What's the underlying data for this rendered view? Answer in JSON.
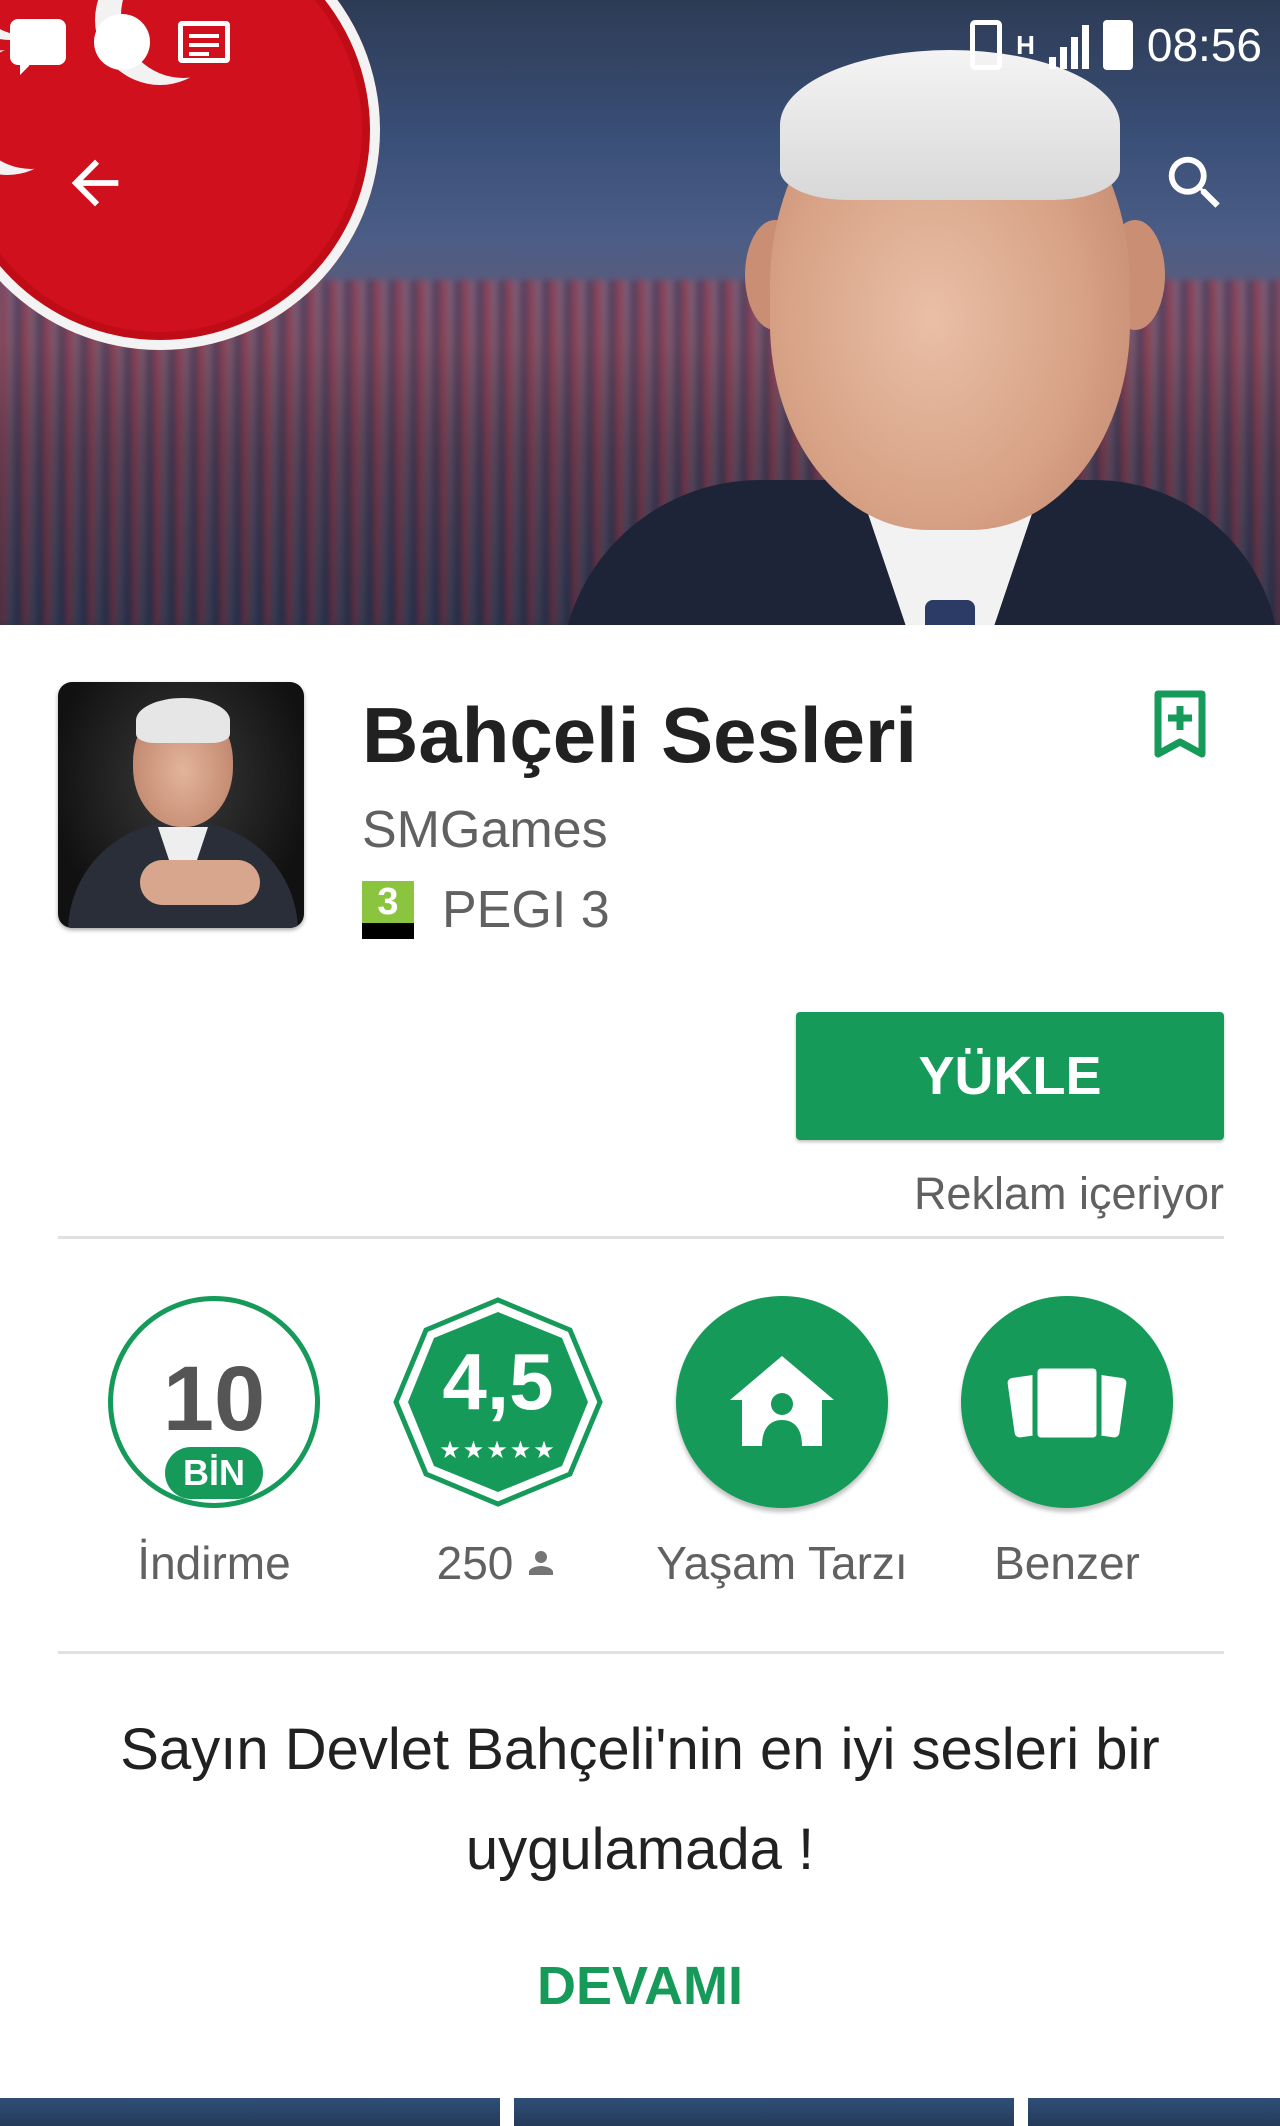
{
  "status_bar": {
    "time": "08:56",
    "network": "H"
  },
  "app": {
    "title": "Bahçeli Sesleri",
    "developer": "SMGames",
    "pegi_number": "3",
    "pegi_label": "PEGI 3",
    "install_label": "YÜKLE",
    "ads_note": "Reklam içeriyor"
  },
  "stats": {
    "downloads_value": "10",
    "downloads_unit": "BİN",
    "downloads_label": "İndirme",
    "rating_value": "4,5",
    "rating_stars": "★★★★★",
    "rating_stars_level": 0.9,
    "reviews_count": "250",
    "category_label": "Yaşam Tarzı",
    "similar_label": "Benzer"
  },
  "description": {
    "text": "Sayın Devlet Bahçeli'nin en iyi sesleri bir uygulamada !",
    "more_label": "DEVAMI"
  },
  "icons": {
    "back": "arrow-back-icon",
    "search": "search-icon",
    "wishlist": "bookmark-add-icon",
    "category": "house-icon",
    "similar": "cards-icon",
    "reviews": "person-icon"
  },
  "colors": {
    "accent": "#169a59",
    "logo_red": "#d0101c"
  }
}
